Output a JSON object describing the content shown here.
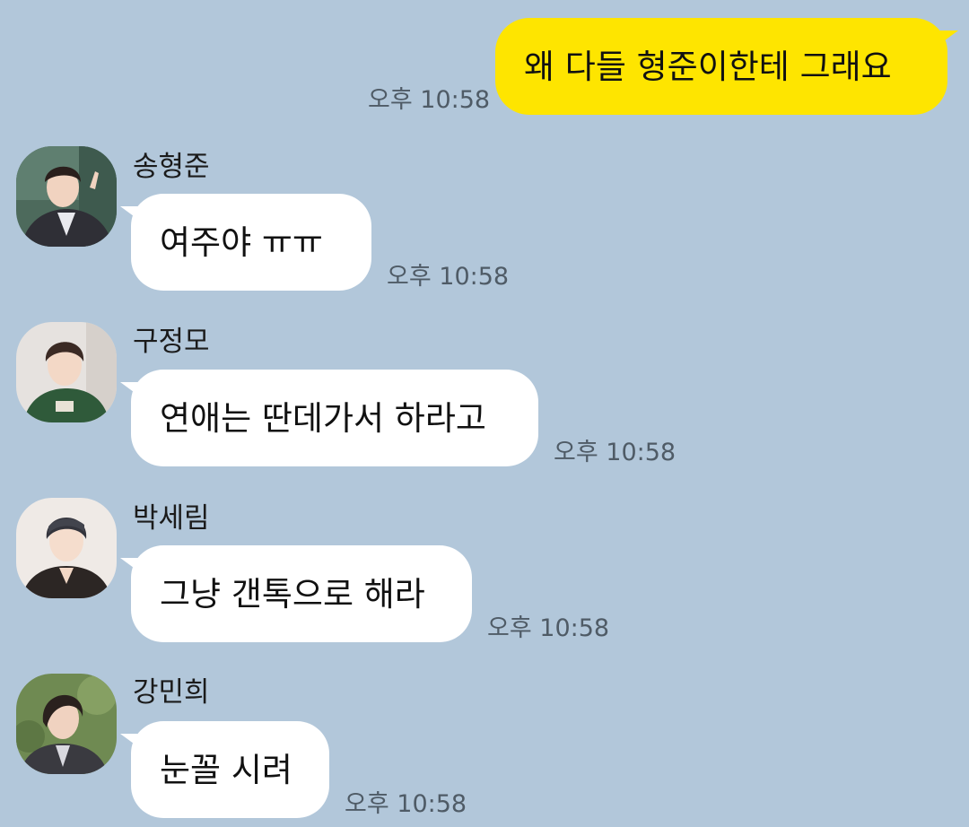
{
  "theme": {
    "background": "#b2c7da",
    "outgoing_bubble": "#fee500",
    "incoming_bubble": "#ffffff",
    "time_color": "#4f5b66"
  },
  "messages": [
    {
      "direction": "outgoing",
      "text": "왜 다들 형준이한테 그래요",
      "time": "오후 10:58"
    },
    {
      "direction": "incoming",
      "sender": "송형준",
      "avatar_icon": "profile-photo-icon",
      "text": "여주야 ㅠㅠ",
      "time": "오후 10:58"
    },
    {
      "direction": "incoming",
      "sender": "구정모",
      "avatar_icon": "profile-photo-icon",
      "text": "연애는 딴데가서 하라고",
      "time": "오후 10:58"
    },
    {
      "direction": "incoming",
      "sender": "박세림",
      "avatar_icon": "profile-photo-icon",
      "text": "그냥 갠톡으로 해라",
      "time": "오후 10:58"
    },
    {
      "direction": "incoming",
      "sender": "강민희",
      "avatar_icon": "profile-photo-icon",
      "text": "눈꼴 시려",
      "time": "오후 10:58"
    }
  ]
}
